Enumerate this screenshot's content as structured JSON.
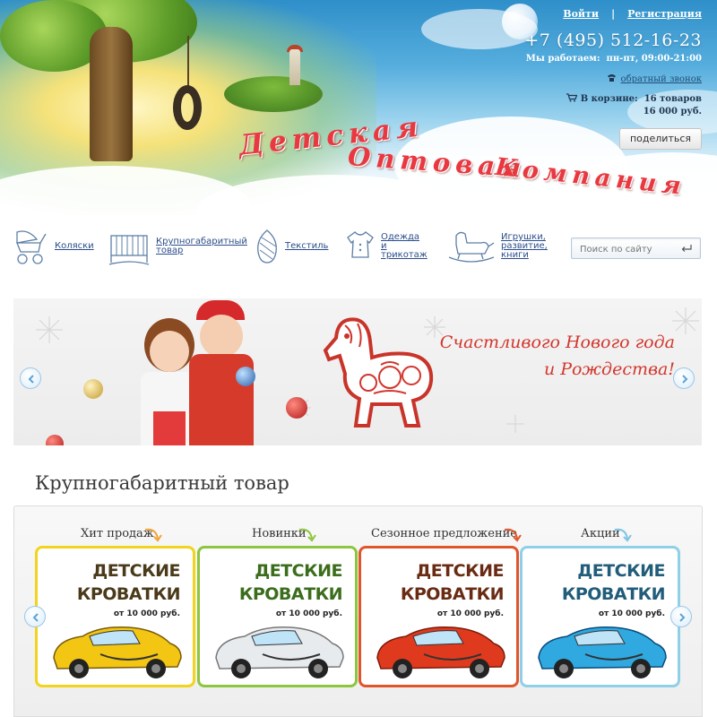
{
  "header": {
    "brand_line1": "Детская",
    "brand_line2": "Оптовая",
    "brand_line3": "Компания",
    "login_label": "Войти",
    "separator": "|",
    "register_label": "Регистрация",
    "phone": "+7 (495) 512-16-23",
    "hours_label": "Мы работаем:",
    "hours_value": "пн-пт, 09:00-21:00",
    "callback_label": "обратный звонок",
    "cart_label": "В корзине:",
    "cart_items": "16 товаров",
    "cart_total": "16 000 руб.",
    "share_label": "поделиться"
  },
  "categories": [
    {
      "label": "Коляски",
      "icon": "stroller-icon"
    },
    {
      "label": "Крупногабаритный товар",
      "icon": "crib-icon"
    },
    {
      "label": "Текстиль",
      "icon": "textile-icon"
    },
    {
      "label": "Одежда и трикотаж",
      "icon": "clothes-icon"
    },
    {
      "label": "Игрушки, развитие, книги",
      "icon": "rocking-horse-icon"
    }
  ],
  "search": {
    "placeholder": "Поиск по сайту"
  },
  "slider": {
    "line1": "Счастливого Нового года",
    "line2": "и Рождества!"
  },
  "section": {
    "title": "Крупногабаритный товар",
    "columns": [
      {
        "label": "Хит продаж",
        "card_line1": "ДЕТСКИЕ",
        "card_line2": "КРОВАТКИ",
        "price": "от 10 000 руб.",
        "accent": "#f2d41c",
        "car_color": "#f2c612",
        "title_color": "#4a3a1a"
      },
      {
        "label": "Новинки",
        "card_line1": "ДЕТСКИЕ",
        "card_line2": "КРОВАТКИ",
        "price": "от 10 000 руб.",
        "accent": "#8cc63f",
        "car_color": "#e8ebee",
        "title_color": "#3b6d1c"
      },
      {
        "label": "Сезонное предложение",
        "card_line1": "ДЕТСКИЕ",
        "card_line2": "КРОВАТКИ",
        "price": "от 10 000 руб.",
        "accent": "#e0562b",
        "car_color": "#e03a1e",
        "title_color": "#6a2b14"
      },
      {
        "label": "Акции",
        "card_line1": "ДЕТСКИЕ",
        "card_line2": "КРОВАТКИ",
        "price": "от 10 000 руб.",
        "accent": "#8fd0e8",
        "car_color": "#2fa9e0",
        "title_color": "#215c7a"
      }
    ]
  },
  "colors": {
    "link": "#2b4d8a",
    "brand_red": "#e9383f",
    "arrow_blue": "#5aa3d6"
  }
}
